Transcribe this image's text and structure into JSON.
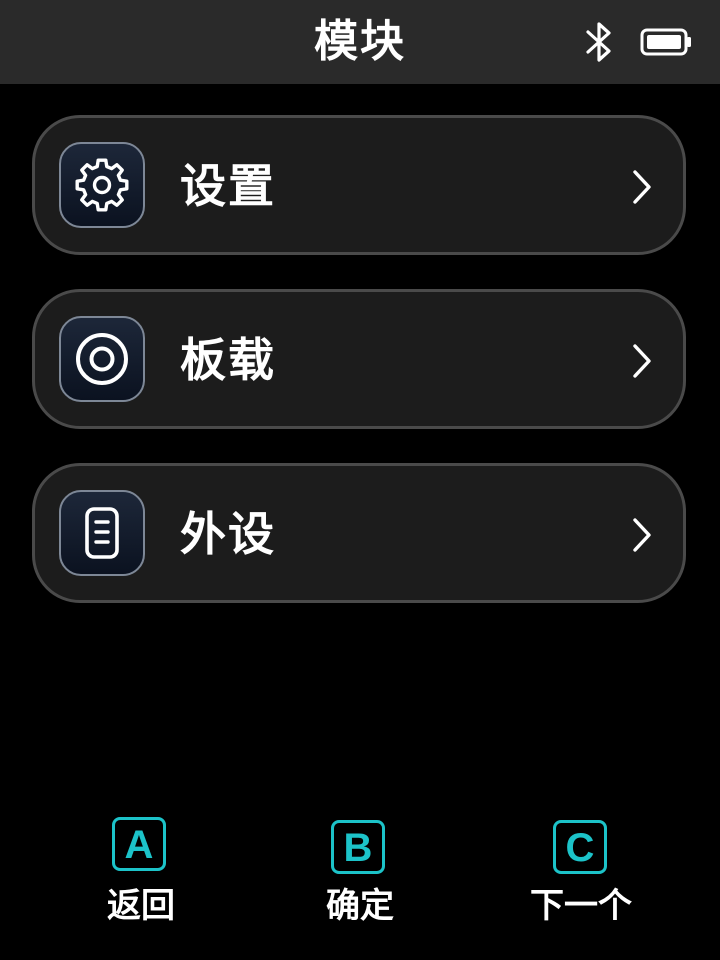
{
  "header": {
    "title": "模块",
    "icons": [
      "bluetooth-icon",
      "battery-icon"
    ]
  },
  "menu": {
    "items": [
      {
        "label": "设置",
        "icon": "gear-icon"
      },
      {
        "label": "板载",
        "icon": "target-icon"
      },
      {
        "label": "外设",
        "icon": "device-icon"
      }
    ]
  },
  "footer": {
    "buttons": [
      {
        "key": "A",
        "label": "返回"
      },
      {
        "key": "B",
        "label": "确定"
      },
      {
        "key": "C",
        "label": "下一个"
      }
    ]
  },
  "colors": {
    "accent": "#1cc3c9",
    "background": "#000000",
    "header_bg": "#2a2a2a",
    "card_bg": "#1c1c1c",
    "card_border": "#4a4a4a"
  }
}
